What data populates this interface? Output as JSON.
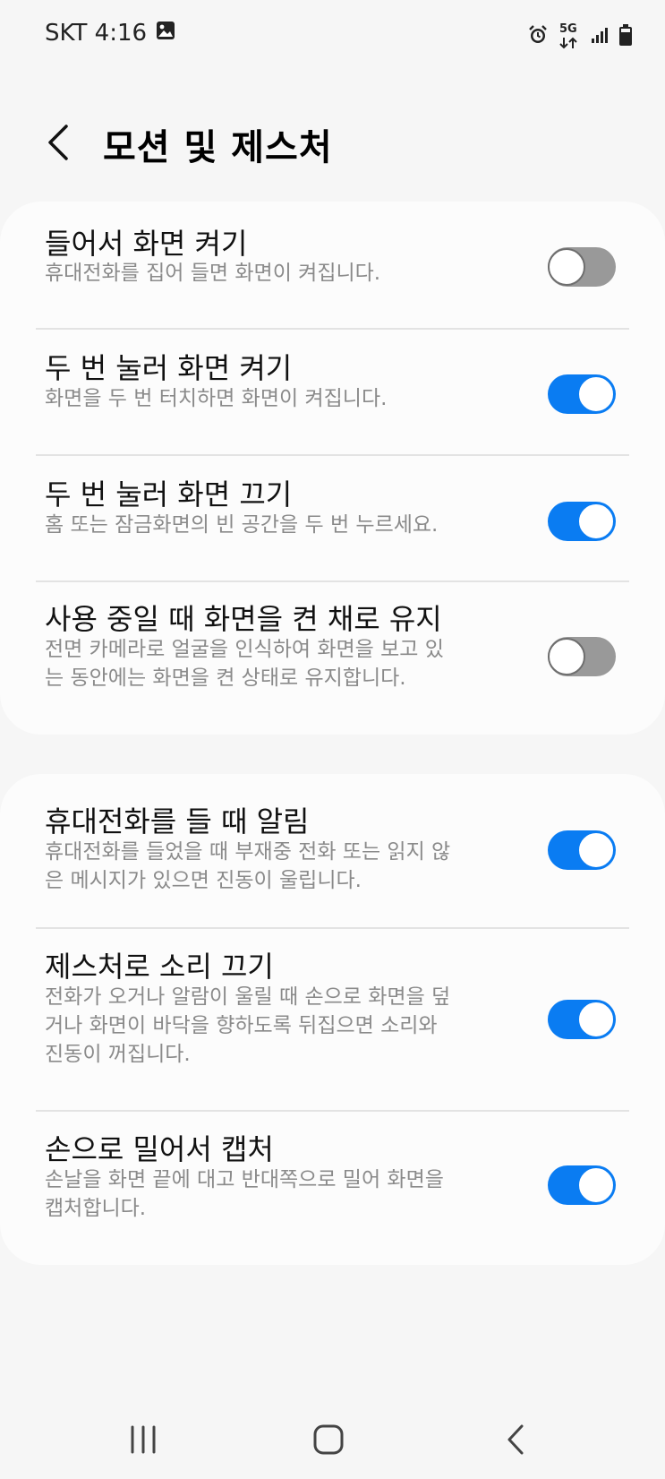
{
  "status_bar": {
    "carrier_time": "SKT 4:16",
    "network": "5G",
    "icons": [
      "gallery-icon",
      "alarm-icon",
      "5g-icon",
      "signal-icon",
      "battery-icon"
    ]
  },
  "header": {
    "title": "모션 및 제스처",
    "back_icon": "chevron-left-icon"
  },
  "sections": [
    {
      "items": [
        {
          "title": "들어서 화면 켜기",
          "desc": [
            "휴대전화를 집어 들면 화면이 켜집니다."
          ],
          "enabled": false
        },
        {
          "title": "두 번 눌러 화면 켜기",
          "desc": [
            "화면을 두 번 터치하면 화면이 켜집니다."
          ],
          "enabled": true
        },
        {
          "title": "두 번 눌러 화면 끄기",
          "desc": [
            "홈 또는 잠금화면의 빈 공간을 두 번 누르세요."
          ],
          "enabled": true
        },
        {
          "title": "사용 중일 때 화면을 켠 채로 유지",
          "desc": [
            "전면 카메라로 얼굴을 인식하여 화면을 보고 있",
            "는 동안에는 화면을 켠 상태로 유지합니다."
          ],
          "enabled": false
        }
      ]
    },
    {
      "items": [
        {
          "title": "휴대전화를 들 때 알림",
          "desc": [
            "휴대전화를 들었을 때 부재중 전화 또는 읽지 않",
            "은 메시지가 있으면 진동이 울립니다."
          ],
          "enabled": true
        },
        {
          "title": "제스처로 소리 끄기",
          "desc": [
            "전화가 오거나 알람이 울릴 때 손으로 화면을 덮",
            "거나 화면이 바닥을 향하도록 뒤집으면 소리와",
            "진동이 꺼집니다."
          ],
          "enabled": true
        },
        {
          "title": "손으로 밀어서 캡처",
          "desc": [
            "손날을 화면 끝에 대고 반대쪽으로 밀어 화면을",
            "캡처합니다."
          ],
          "enabled": true
        }
      ]
    }
  ],
  "colors": {
    "accent": "#0a7cf2",
    "toggle_off": "#999999",
    "background": "#f6f6f6",
    "card": "#fcfcfc",
    "secondary_text": "#8a8a8a"
  },
  "nav_bar": {
    "icons": [
      "recent-apps-icon",
      "home-icon",
      "back-icon"
    ]
  }
}
